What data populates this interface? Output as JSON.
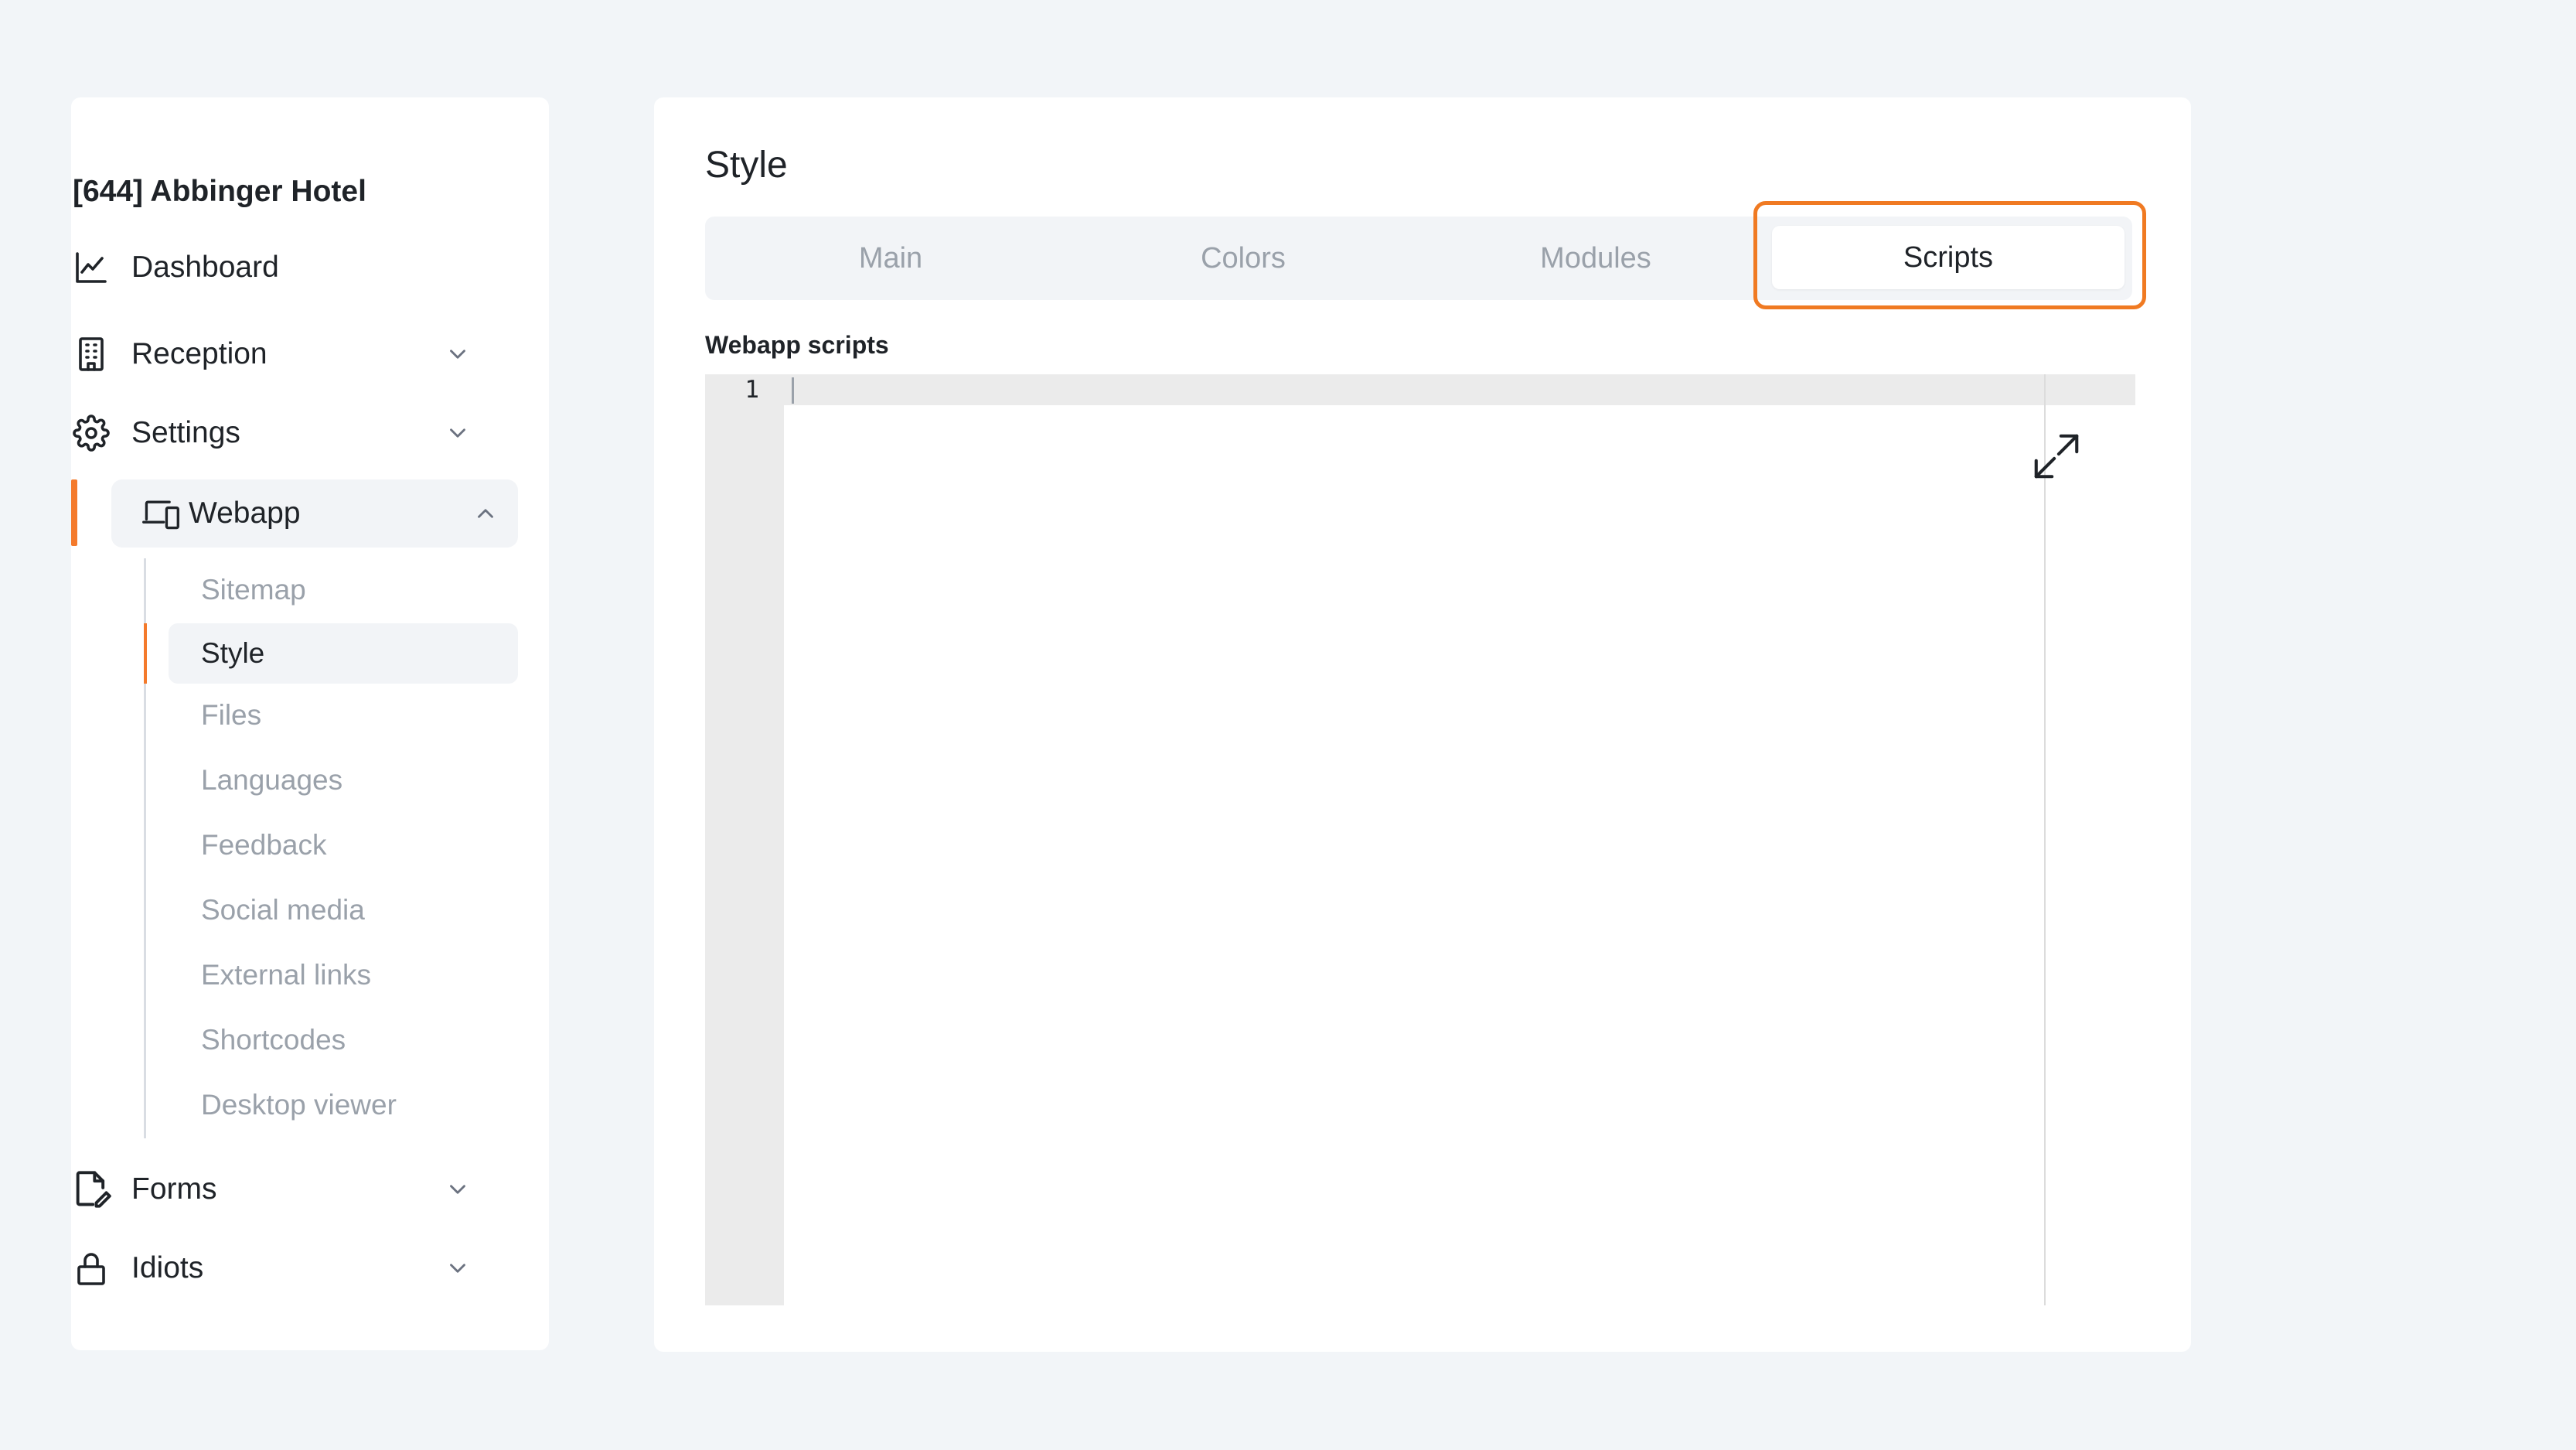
{
  "sidebar": {
    "hotel_name": "[644] Abbinger Hotel",
    "items": [
      {
        "label": "Dashboard",
        "icon": "chart-line-icon"
      },
      {
        "label": "Reception",
        "icon": "building-icon"
      },
      {
        "label": "Settings",
        "icon": "gear-icon"
      },
      {
        "label": "Webapp",
        "icon": "devices-icon"
      },
      {
        "label": "Forms",
        "icon": "file-edit-icon"
      },
      {
        "label": "Idiots",
        "icon": "lock-icon"
      }
    ],
    "webapp_subitems": [
      "Sitemap",
      "Style",
      "Files",
      "Languages",
      "Feedback",
      "Social media",
      "External links",
      "Shortcodes",
      "Desktop viewer"
    ],
    "active_item": "Webapp",
    "active_subitem": "Style"
  },
  "main": {
    "title": "Style",
    "tabs": [
      "Main",
      "Colors",
      "Modules",
      "Scripts"
    ],
    "selected_tab": "Scripts",
    "field_label": "Webapp scripts",
    "editor": {
      "line_numbers": [
        "1"
      ],
      "content": ""
    }
  },
  "colors": {
    "accent": "#f47a2b",
    "background": "#f2f5f8",
    "muted_text": "#9aa1aa"
  }
}
